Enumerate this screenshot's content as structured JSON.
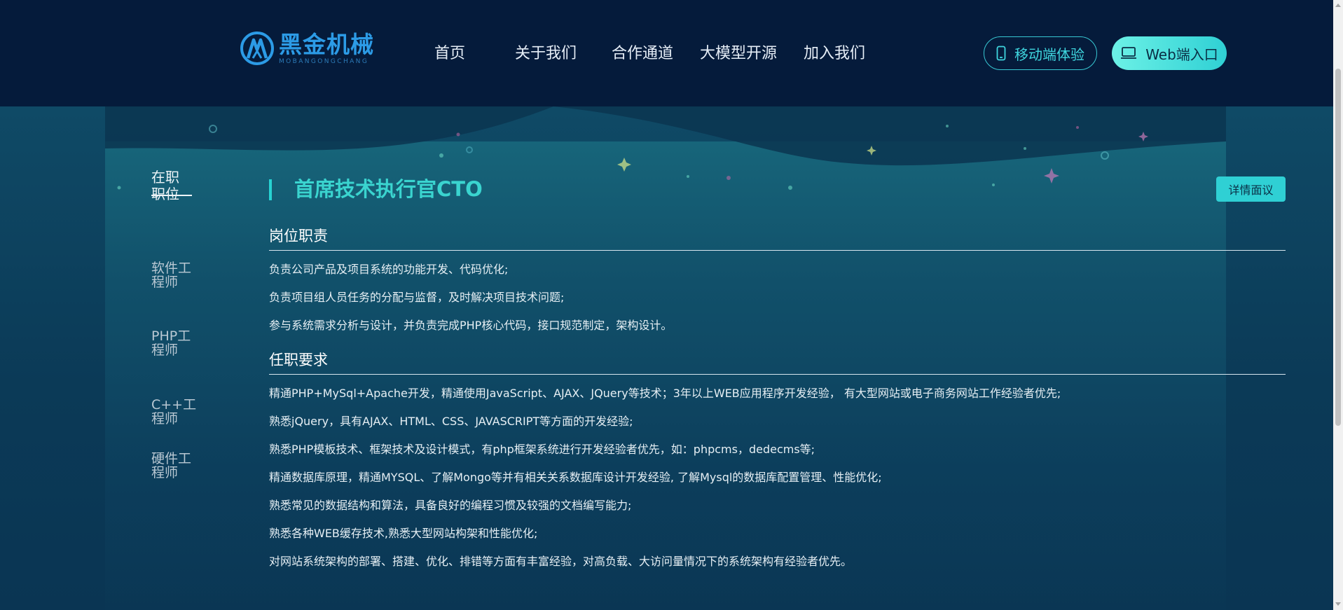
{
  "header": {
    "logo": {
      "name": "黑金机械",
      "subtitle": "MOBANGONGCHANG"
    },
    "nav": [
      {
        "label": "首页"
      },
      {
        "label": "关于我们"
      },
      {
        "label": "合作通道"
      },
      {
        "label": "大模型开源"
      },
      {
        "label": "加入我们"
      }
    ],
    "mobile_button": {
      "label": "移动端体验",
      "icon": "phone-icon"
    },
    "web_button": {
      "label": "Web端入口",
      "icon": "laptop-icon"
    }
  },
  "sidebar": {
    "title": "在职职位",
    "items": [
      {
        "label": "软件工程师"
      },
      {
        "label": "PHP工程师"
      },
      {
        "label": "C++工程师"
      },
      {
        "label": "硬件工程师"
      }
    ]
  },
  "job": {
    "title": "首席技术执行官CTO",
    "detail_button": "详情面议",
    "duties_heading": "岗位职责",
    "duties": [
      "负责公司产品及项目系统的功能开发、代码优化;",
      "负责项目组人员任务的分配与监督，及时解决项目技术问题;",
      "参与系统需求分析与设计，并负责完成PHP核心代码，接口规范制定，架构设计。"
    ],
    "requirements_heading": "任职要求",
    "requirements": [
      "精通PHP+MySql+Apache开发，精通使用JavaScript、AJAX、JQuery等技术；3年以上WEB应用程序开发经验， 有大型网站或电子商务网站工作经验者优先;",
      "熟悉jQuery，具有AJAX、HTML、CSS、JAVASCRIPT等方面的开发经验;",
      "熟悉PHP模板技术、框架技术及设计模式，有php框架系统进行开发经验者优先，如：phpcms，dedecms等;",
      "精通数据库原理，精通MYSQL、了解Mongo等并有相关关系数据库设计开发经验, 了解Mysql的数据库配置管理、性能优化;",
      "熟悉常见的数据结构和算法，具备良好的编程习惯及较强的文档编写能力;",
      "熟悉各种WEB缓存技术,熟悉大型网站构架和性能优化;",
      "对网站系统架构的部署、搭建、优化、排错等方面有丰富经验，对高负载、大访问量情况下的系统架构有经验者优先。"
    ]
  },
  "colors": {
    "header_bg": "#051b3b",
    "accent": "#2fd0d4",
    "title": "#3ad4cf",
    "logo": "#2c9be6"
  }
}
